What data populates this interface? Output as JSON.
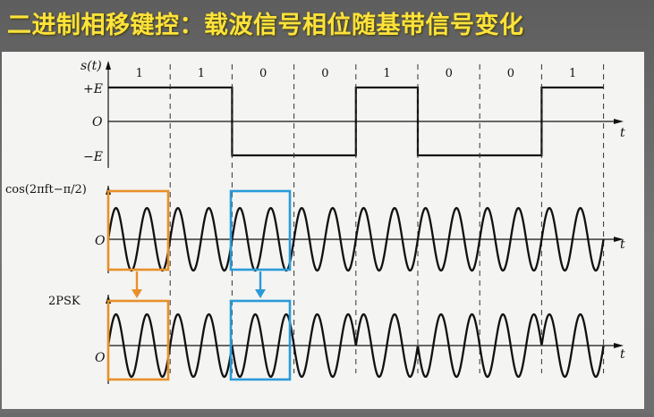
{
  "title": "二进制相移键控：载波信号相位随基带信号变化",
  "diagram": {
    "bits": [
      "1",
      "1",
      "0",
      "0",
      "1",
      "0",
      "0",
      "1"
    ],
    "baseband": {
      "ylabel": "s(t)",
      "high_label": "+E",
      "zero_label": "O",
      "low_label": "−E",
      "axis_label": "t"
    },
    "carrier": {
      "label": "cos(2πft−π/2)",
      "zero_label": "O",
      "axis_label": "t"
    },
    "psk": {
      "label": "2PSK",
      "zero_label": "O",
      "axis_label": "t"
    },
    "cycles_per_bit": 2,
    "colors": {
      "highlight_orange": "#e8902a",
      "highlight_blue": "#2a9ad8",
      "waveform": "#111111",
      "panel": "#f4f4f2"
    }
  }
}
